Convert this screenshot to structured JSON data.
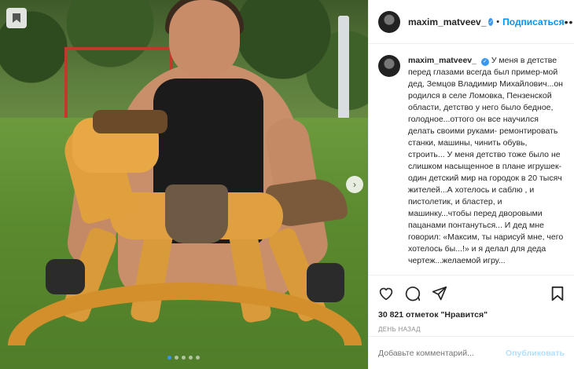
{
  "post": {
    "username": "maxim_matveev_",
    "follow_label": "Подписаться",
    "more_label": "•••",
    "caption": "У меня в детстве перед глазами всегда был пример-мой дед, Земцов Владимир Михайлович...он родился в селе Ломовка, Пензенской области, детство у него было бедное, голодное...оттого он все научился делать своими руками- ремонтировать станки, машины, чинить обувь, строить... У меня детство тоже было не слишком насыщенное в плане игрушек-один детский мир на городок в 20 тысяч жителей...А хотелось и саблю , и пистолетик, и бластер, и машинку...чтобы перед дворовыми пацанами понтануться... И дед мне говорил: «Максим, ты нарисуй мне, чего хотелось бы...!» и я делал для деда чертеж...желаемой игру...",
    "likes": "30 821 отметок \"Нравится\"",
    "time_ago": "ДЕНЬ НАЗАД",
    "comment_placeholder": "Добавьте комментарий...",
    "publish_label": "Опубликовать"
  },
  "media": {
    "carousel_dots": 5,
    "active_dot": 0
  },
  "icons": {
    "save": "bookmark-icon",
    "next": "chevron-right-icon",
    "like": "heart-icon",
    "comment": "comment-icon",
    "share": "share-icon",
    "bookmark": "bookmark-icon",
    "verified": "verified-badge-icon"
  },
  "colors": {
    "accent": "#0095f6",
    "publish_disabled": "#b2dffc",
    "verified": "#3897f0"
  }
}
